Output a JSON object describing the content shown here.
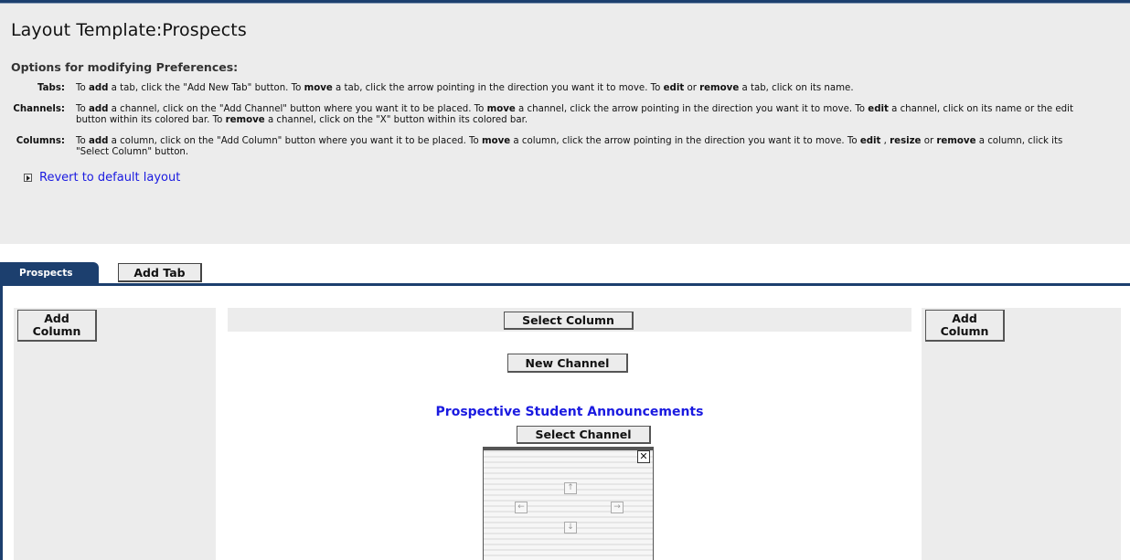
{
  "page": {
    "title": "Layout Template:Prospects",
    "options_heading": "Options for modifying Preferences:"
  },
  "options": [
    {
      "label": "Tabs:",
      "parts": [
        "To ",
        "add",
        " a tab, click the \"Add New Tab\" button. To ",
        "move",
        " a tab, click the arrow pointing in the direction you want it to move. To ",
        "edit",
        " or ",
        "remove",
        " a tab, click on its name."
      ]
    },
    {
      "label": "Channels:",
      "parts": [
        "To ",
        "add",
        " a channel, click on the \"Add Channel\" button where you want it to be placed. To ",
        "move",
        " a channel, click the arrow pointing in the direction you want it to move. To ",
        "edit",
        " a channel, click on its name or the edit button within its colored bar. To ",
        "remove",
        " a channel, click on the \"X\" button within its colored bar."
      ]
    },
    {
      "label": "Columns:",
      "parts": [
        "To ",
        "add",
        " a column, click on the \"Add Column\" button where you want it to be placed. To ",
        "move",
        " a column, click the arrow pointing in the direction you want it to move. To ",
        "edit",
        " , ",
        "resize",
        " or ",
        "remove",
        " a column, click its \"Select Column\" button."
      ]
    }
  ],
  "revert_link": "Revert to default layout",
  "tabs": {
    "active": "Prospects",
    "add_tab": "Add Tab"
  },
  "columns": {
    "add_column_left": "Add\nColumn",
    "add_column_right": "Add\nColumn",
    "select_column": "Select Column",
    "new_channel": "New Channel"
  },
  "channel": {
    "title": "Prospective Student Announcements",
    "select_channel": "Select Channel",
    "close": "✕",
    "arrows": {
      "up": "↑",
      "left": "←",
      "right": "→",
      "down": "↓"
    }
  },
  "colors": {
    "accent": "#1c3f6e",
    "link": "#1a1ae0",
    "panel": "#ececec"
  }
}
